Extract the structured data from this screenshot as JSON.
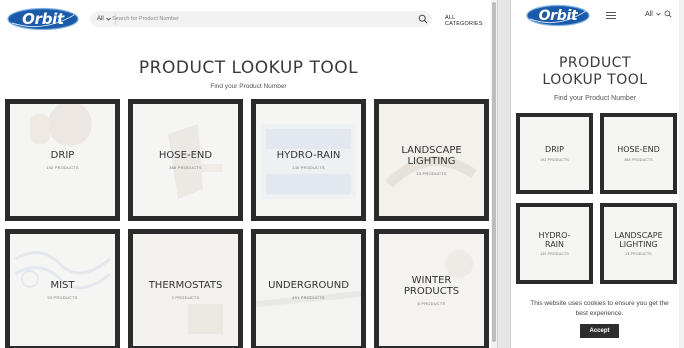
{
  "brand": {
    "logo_text": "Orbit",
    "logo_color": "#1a5aa8",
    "accent": "#2b2b2b"
  },
  "desktop": {
    "search": {
      "scope": "All",
      "placeholder": "Search for Product Number"
    },
    "all_categories": "ALL CATEGORIES",
    "title": "PRODUCT LOOKUP TOOL",
    "subtitle": "Find your Product Number",
    "tiles": [
      {
        "name": "DRIP",
        "count": "192 PRODUCTS"
      },
      {
        "name": "HOSE-END",
        "count": "368 PRODUCTS"
      },
      {
        "name": "HYDRO-RAIN",
        "count": "130 PRODUCTS"
      },
      {
        "name": "LANDSCAPE LIGHTING",
        "count": "13 PRODUCTS"
      },
      {
        "name": "MIST",
        "count": "53 PRODUCTS"
      },
      {
        "name": "THERMOSTATS",
        "count": "2 PRODUCTS"
      },
      {
        "name": "UNDERGROUND",
        "count": "491 PRODUCTS"
      },
      {
        "name": "WINTER PRODUCTS",
        "count": "6 PRODUCTS"
      }
    ]
  },
  "mobile": {
    "scope": "All",
    "title_line1": "PRODUCT",
    "title_line2": "LOOKUP TOOL",
    "subtitle": "Find your Product Number",
    "tiles": [
      {
        "name": "DRIP",
        "count": "192 PRODUCTS"
      },
      {
        "name": "HOSE-END",
        "count": "368 PRODUCTS"
      },
      {
        "name": "HYDRO- RAIN",
        "count": "130 PRODUCTS"
      },
      {
        "name": "LANDSCAPE LIGHTING",
        "count": "13 PRODUCTS"
      }
    ],
    "cookie": {
      "text": "This website uses cookies to ensure you get the best experience.",
      "accept": "Accept"
    }
  }
}
